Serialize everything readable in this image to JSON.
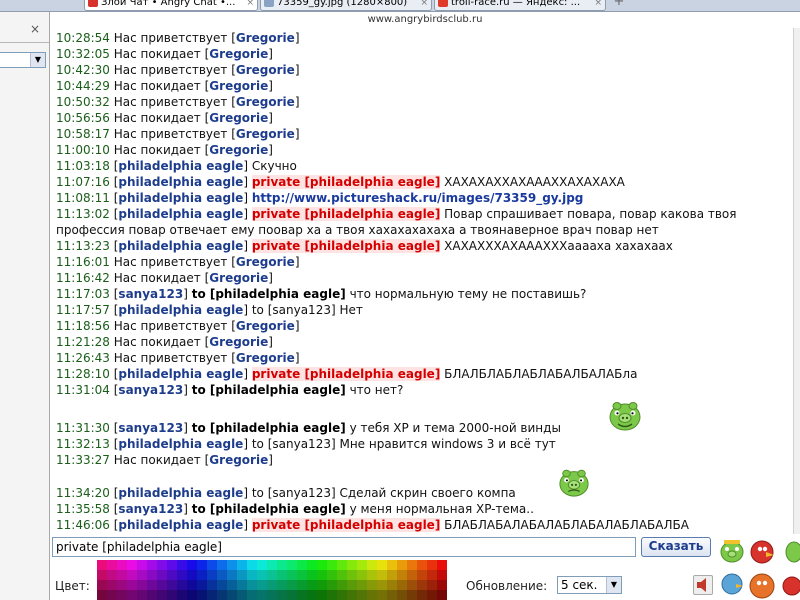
{
  "browser": {
    "tabs": [
      {
        "label": "Злой Чат • Angry Chat •...",
        "active": true,
        "icon_color": "#d8322c"
      },
      {
        "label": "73359_gy.jpg (1280×800)",
        "active": false,
        "icon_color": "#8aa2c4"
      },
      {
        "label": "troll-race.ru — Яндекс: ...",
        "active": false,
        "icon_color": "#e03a2a"
      }
    ],
    "url": "www.angrybirdsclub.ru"
  },
  "left_panel": {
    "close_glyph": "×"
  },
  "chat": {
    "messages": [
      {
        "time": "10:28:54",
        "system": "Нас приветствует",
        "nick": "Gregorie"
      },
      {
        "time": "10:32:05",
        "system": "Нас покидает",
        "nick": "Gregorie"
      },
      {
        "time": "10:42:30",
        "system": "Нас приветствует",
        "nick": "Gregorie"
      },
      {
        "time": "10:44:29",
        "system": "Нас покидает",
        "nick": "Gregorie"
      },
      {
        "time": "10:50:32",
        "system": "Нас приветствует",
        "nick": "Gregorie"
      },
      {
        "time": "10:56:56",
        "system": "Нас покидает",
        "nick": "Gregorie"
      },
      {
        "time": "10:58:17",
        "system": "Нас приветствует",
        "nick": "Gregorie"
      },
      {
        "time": "11:00:10",
        "system": "Нас покидает",
        "nick": "Gregorie"
      },
      {
        "time": "11:03:18",
        "nick": "philadelphia eagle",
        "text": "Скучно"
      },
      {
        "time": "11:07:16",
        "nick": "philadelphia eagle",
        "private": "private [philadelphia eagle]",
        "text": "ХАХАХАХХАХАААХХАХАХАХА"
      },
      {
        "time": "11:08:11",
        "nick": "philadelphia eagle",
        "link": "http://www.pictureshack.ru/images/73359_gy.jpg"
      },
      {
        "time": "11:13:02",
        "nick": "philadelphia eagle",
        "private": "private [philadelphia eagle]",
        "text": "Повар спрашивает повара, повар какова твоя профессия повар отвечает ему поовар ха а твоя хахахахахаха а твоянаверное врач повар нет"
      },
      {
        "time": "11:13:23",
        "nick": "philadelphia eagle",
        "private": "private [philadelphia eagle]",
        "text": "ХАХАХХХАХАААХХХааааха хахахаах"
      },
      {
        "time": "11:16:01",
        "system": "Нас приветствует",
        "nick": "Gregorie"
      },
      {
        "time": "11:16:42",
        "system": "Нас покидает",
        "nick": "Gregorie"
      },
      {
        "time": "11:17:03",
        "nick": "sanya123",
        "to": "to [philadelphia eagle]",
        "text": "что нормальную тему не поставишь?"
      },
      {
        "time": "11:17:57",
        "nick": "philadelphia eagle",
        "to_plain": "to [sanya123]",
        "text": "Нет"
      },
      {
        "time": "11:18:56",
        "system": "Нас приветствует",
        "nick": "Gregorie"
      },
      {
        "time": "11:21:28",
        "system": "Нас покидает",
        "nick": "Gregorie"
      },
      {
        "time": "11:26:43",
        "system": "Нас приветствует",
        "nick": "Gregorie"
      },
      {
        "time": "11:28:10",
        "nick": "philadelphia eagle",
        "private": "private [philadelphia eagle]",
        "text": "БЛАЛБЛАБЛАБЛАБАЛБАЛАБла"
      },
      {
        "time": "11:31:04",
        "nick": "sanya123",
        "to": "to [philadelphia eagle]",
        "text": "что нет?"
      },
      {
        "time": "11:31:30",
        "nick": "sanya123",
        "to": "to [philadelphia eagle]",
        "text": "у тебя XP и тема 2000-ной винды"
      },
      {
        "time": "11:32:13",
        "nick": "philadelphia eagle",
        "to_plain": "to [sanya123]",
        "text": "Мне нравится windows 3 и всё тут"
      },
      {
        "time": "11:33:27",
        "system": "Нас покидает",
        "nick": "Gregorie"
      },
      {
        "time": "11:34:20",
        "nick": "philadelphia eagle",
        "to_plain": "to [sanya123]",
        "text": "Сделай скрин своего компа"
      },
      {
        "time": "11:35:58",
        "nick": "sanya123",
        "to": "to [philadelphia eagle]",
        "text": "у меня нормальная XP-тема.."
      },
      {
        "time": "11:46:06",
        "nick": "philadelphia eagle",
        "private": "private [philadelphia eagle]",
        "text": "БЛАБЛАБАЛАБАЛАБЛАБАЛАБЛАБАЛБА"
      }
    ]
  },
  "input": {
    "value": "private [philadelphia eagle]",
    "send_label": "Сказать"
  },
  "toolbar": {
    "color_label": "Цвет:",
    "update_label": "Обновление:",
    "update_value": "5 сек."
  },
  "icons": {
    "smiley": "green-pig-smiley-icon",
    "sound": "speaker-mute-icon",
    "birds": "angry-birds-icon"
  }
}
